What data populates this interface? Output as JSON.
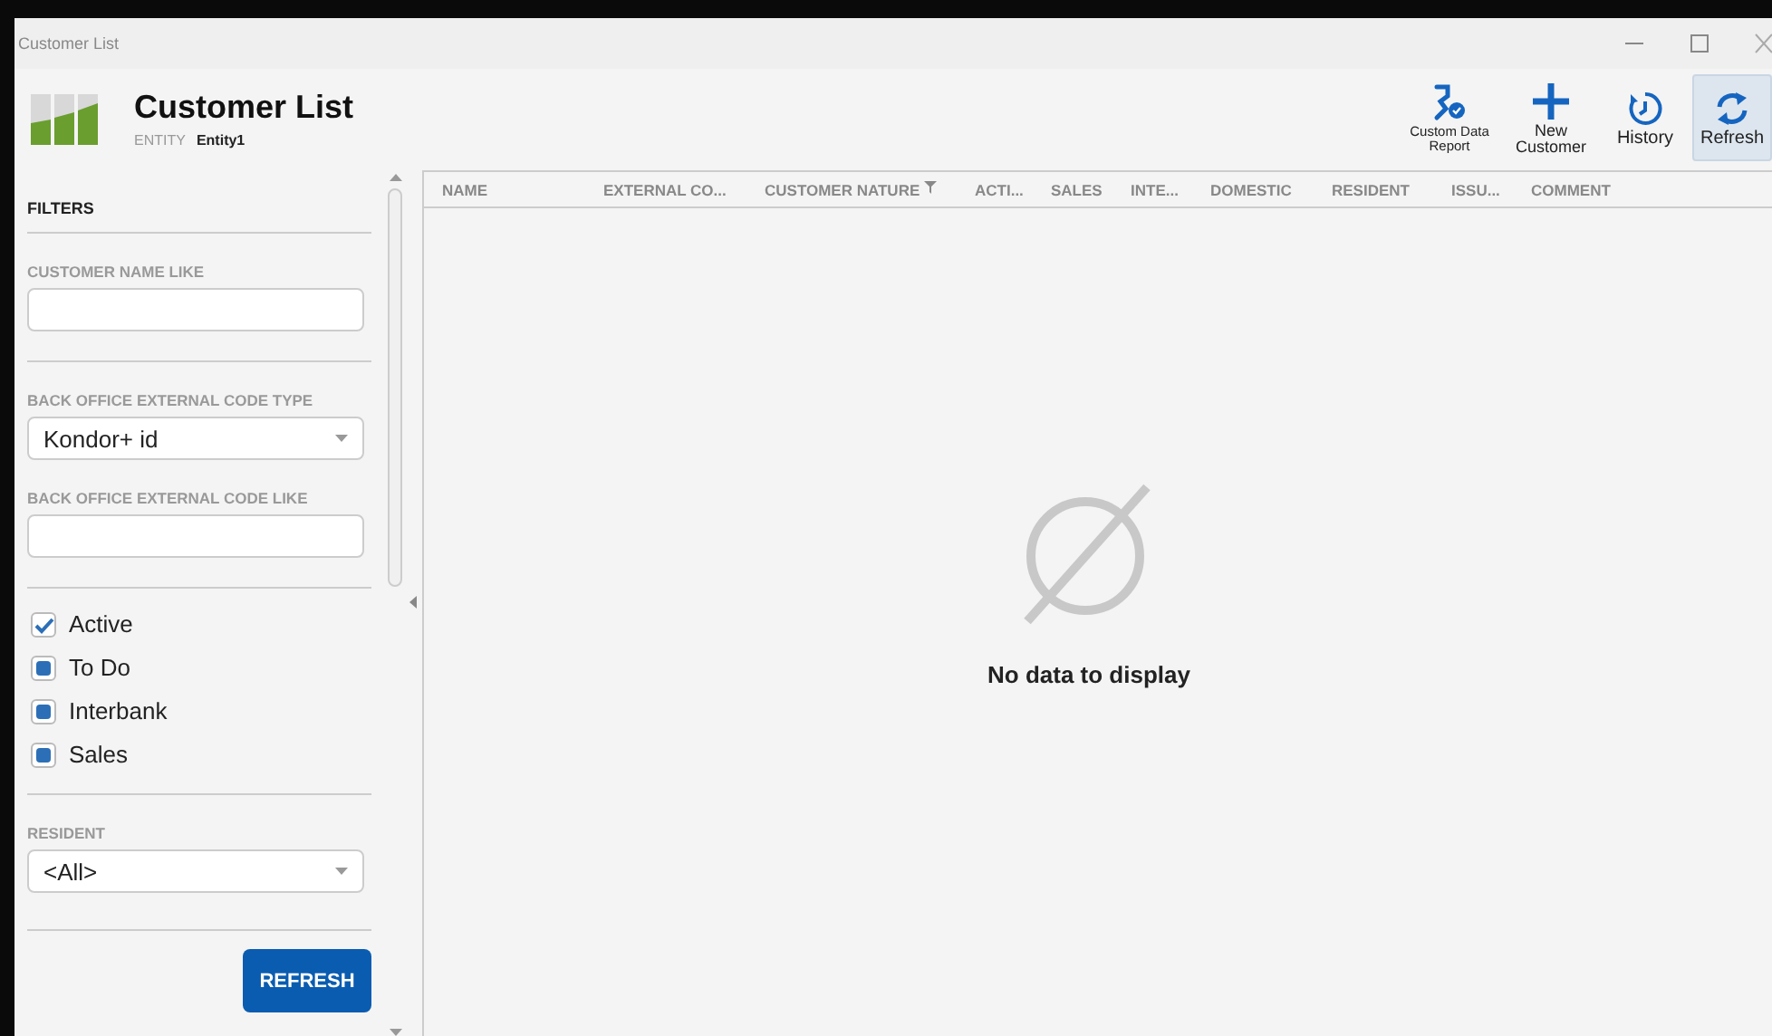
{
  "window": {
    "title": "Customer List"
  },
  "header": {
    "title": "Customer List",
    "entity_label": "ENTITY",
    "entity_value": "Entity1"
  },
  "toolbar": [
    {
      "kind": "report",
      "label": "Custom Data Report",
      "selected": false
    },
    {
      "kind": "new",
      "label": "New Customer",
      "selected": false
    },
    {
      "kind": "history",
      "label": "History",
      "selected": false
    },
    {
      "kind": "refresh",
      "label": "Refresh",
      "selected": true
    }
  ],
  "filters": {
    "title": "FILTERS",
    "customer_name": {
      "label": "CUSTOMER NAME LIKE"
    },
    "code_type": {
      "label": "BACK OFFICE EXTERNAL CODE TYPE",
      "value": "Kondor+ id"
    },
    "code_like": {
      "label": "BACK OFFICE EXTERNAL CODE LIKE"
    },
    "checkboxes": [
      {
        "label": "Active",
        "checked": true,
        "indeterminate": false
      },
      {
        "label": "To Do",
        "checked": false,
        "indeterminate": true
      },
      {
        "label": "Interbank",
        "checked": false,
        "indeterminate": true
      },
      {
        "label": "Sales",
        "checked": false,
        "indeterminate": true
      }
    ],
    "resident": {
      "label": "RESIDENT",
      "value": "<All>"
    },
    "button": "REFRESH"
  },
  "table": {
    "columns": [
      {
        "label": "NAME",
        "filtered": false
      },
      {
        "label": "EXTERNAL CO...",
        "filtered": false
      },
      {
        "label": "CUSTOMER NATURE",
        "filtered": true
      },
      {
        "label": "ACTI...",
        "filtered": false
      },
      {
        "label": "SALES",
        "filtered": false
      },
      {
        "label": "INTE...",
        "filtered": false
      },
      {
        "label": "DOMESTIC",
        "filtered": false
      },
      {
        "label": "RESIDENT",
        "filtered": false
      },
      {
        "label": "ISSU...",
        "filtered": false
      },
      {
        "label": "COMMENT",
        "filtered": false
      }
    ],
    "empty_message": "No data to display"
  }
}
